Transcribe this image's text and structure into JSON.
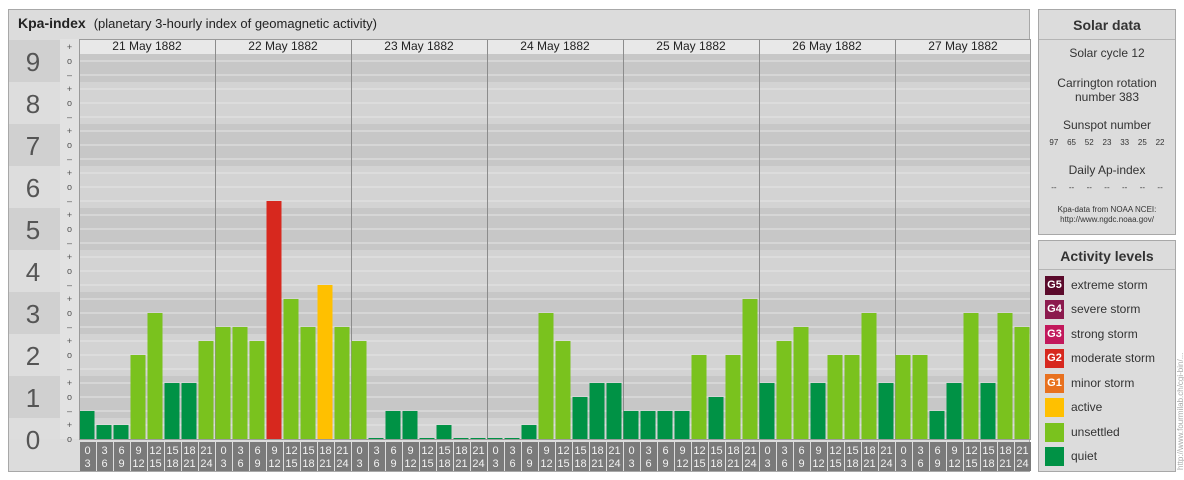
{
  "header": {
    "title": "Kpa-index",
    "subtitle": "(planetary 3-hourly index of geomagnetic activity)"
  },
  "chart_data": {
    "type": "bar",
    "title": "Kpa-index",
    "subtitle": "(planetary 3-hourly index of geomagnetic activity)",
    "ylim": [
      0,
      9
    ],
    "y_ticks": [
      "0",
      "1",
      "2",
      "3",
      "4",
      "5",
      "6",
      "7",
      "8",
      "9"
    ],
    "sub_ticks": [
      "+",
      "o",
      "–"
    ],
    "days": [
      "21 May 1882",
      "22 May 1882",
      "23 May 1882",
      "24 May 1882",
      "25 May 1882",
      "26 May 1882",
      "27 May 1882"
    ],
    "interval_starts": [
      "0",
      "3",
      "6",
      "9",
      "12",
      "15",
      "18",
      "21"
    ],
    "interval_ends": [
      "3",
      "6",
      "9",
      "12",
      "15",
      "18",
      "21",
      "24"
    ],
    "values": [
      [
        0.667,
        0.333,
        0.333,
        2.0,
        3.0,
        1.333,
        1.333,
        2.333
      ],
      [
        2.667,
        2.667,
        2.333,
        5.667,
        3.333,
        2.667,
        3.667,
        2.667
      ],
      [
        2.333,
        0.0,
        0.667,
        0.667,
        0.0,
        0.333,
        0.0,
        0.0
      ],
      [
        0.0,
        0.0,
        0.333,
        3.0,
        2.333,
        1.0,
        1.333,
        1.333
      ],
      [
        0.667,
        0.667,
        0.667,
        0.667,
        2.0,
        1.0,
        2.0,
        3.333
      ],
      [
        1.333,
        2.333,
        2.667,
        1.333,
        2.0,
        2.0,
        3.0,
        1.333
      ],
      [
        2.0,
        2.0,
        0.667,
        1.333,
        3.0,
        1.333,
        3.0,
        2.667
      ]
    ],
    "levels": [
      {
        "name": "quiet",
        "max": 1.5,
        "color": "#009245"
      },
      {
        "name": "unsettled",
        "max": 3.5,
        "color": "#7ac21e"
      },
      {
        "name": "active",
        "max": 4.5,
        "color": "#ffc000"
      },
      {
        "name": "minor storm",
        "max": 5.5,
        "color": "#e8711f"
      },
      {
        "name": "moderate storm",
        "max": 6.5,
        "color": "#d7281e"
      },
      {
        "name": "strong storm",
        "max": 7.5,
        "color": "#c2185b"
      },
      {
        "name": "severe storm",
        "max": 8.5,
        "color": "#8c1a4e"
      },
      {
        "name": "extreme storm",
        "max": 9.5,
        "color": "#5a0a2b"
      }
    ]
  },
  "solar": {
    "title": "Solar data",
    "cycle": "Solar cycle 12",
    "carrington_line1": "Carrington rotation",
    "carrington_line2": "number 383",
    "sunspot_label": "Sunspot number",
    "sunspot_values": [
      "97",
      "65",
      "52",
      "23",
      "33",
      "25",
      "22"
    ],
    "ap_label": "Daily Ap-index",
    "ap_values": [
      "--",
      "--",
      "--",
      "--",
      "--",
      "--",
      "--"
    ],
    "source_line1": "Kpa-data from NOAA NCEI:",
    "source_line2": "http://www.ngdc.noaa.gov/"
  },
  "activity": {
    "title": "Activity levels",
    "items": [
      {
        "code": "G5",
        "label": "extreme storm",
        "color": "#5a0a2b"
      },
      {
        "code": "G4",
        "label": "severe storm",
        "color": "#8c1a4e"
      },
      {
        "code": "G3",
        "label": "strong storm",
        "color": "#c2185b"
      },
      {
        "code": "G2",
        "label": "moderate storm",
        "color": "#d7281e"
      },
      {
        "code": "G1",
        "label": "minor storm",
        "color": "#e8711f"
      },
      {
        "code": "",
        "label": "active",
        "color": "#ffc000"
      },
      {
        "code": "",
        "label": "unsettled",
        "color": "#7ac21e"
      },
      {
        "code": "",
        "label": "quiet",
        "color": "#009245"
      }
    ]
  },
  "watermark": "http://www.fourmilab.ch/cgi-bin/..."
}
